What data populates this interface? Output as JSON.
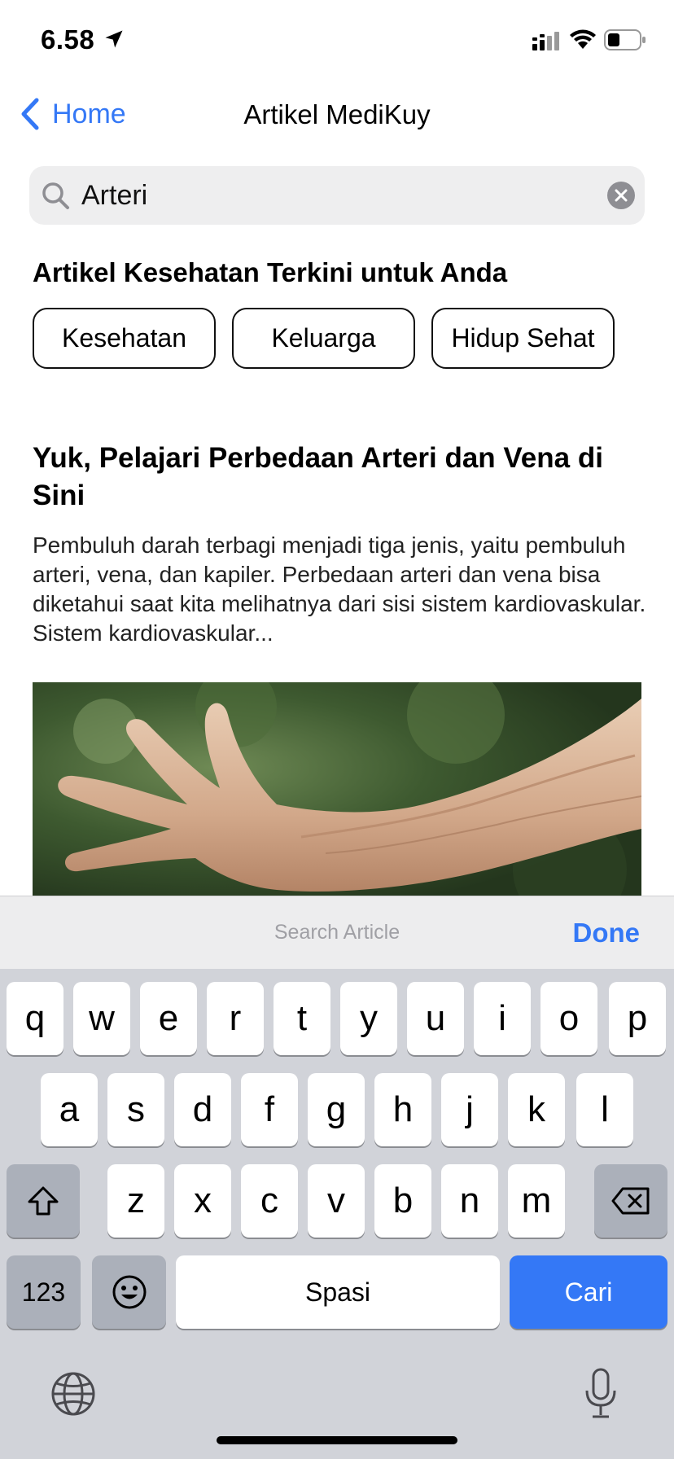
{
  "status_bar": {
    "time": "6.58"
  },
  "nav": {
    "back_label": "Home",
    "title": "Artikel MediKuy"
  },
  "search": {
    "value": "Arteri"
  },
  "section": {
    "heading": "Artikel Kesehatan Terkini untuk Anda"
  },
  "categories": [
    "Kesehatan",
    "Keluarga",
    "Hidup Sehat"
  ],
  "article": {
    "title": "Yuk, Pelajari Perbedaan Arteri dan Vena di Sini",
    "description": "Pembuluh darah terbagi menjadi tiga jenis, yaitu pembuluh arteri, vena, dan kapiler. Perbedaan arteri dan vena bisa diketahui saat kita melihatnya dari sisi sistem kardiovaskular. Sistem kardiovaskular..."
  },
  "keyboard_accessory": {
    "placeholder": "Search Article",
    "done_label": "Done"
  },
  "keyboard": {
    "row1": [
      "q",
      "w",
      "e",
      "r",
      "t",
      "y",
      "u",
      "i",
      "o",
      "p"
    ],
    "row2": [
      "a",
      "s",
      "d",
      "f",
      "g",
      "h",
      "j",
      "k",
      "l"
    ],
    "row3": [
      "z",
      "x",
      "c",
      "v",
      "b",
      "n",
      "m"
    ],
    "numbers_label": "123",
    "space_label": "Spasi",
    "search_label": "Cari"
  },
  "colors": {
    "accent": "#3478F6",
    "keyboard_bg": "#D1D3D9",
    "search_bg": "#EEEEEF"
  }
}
